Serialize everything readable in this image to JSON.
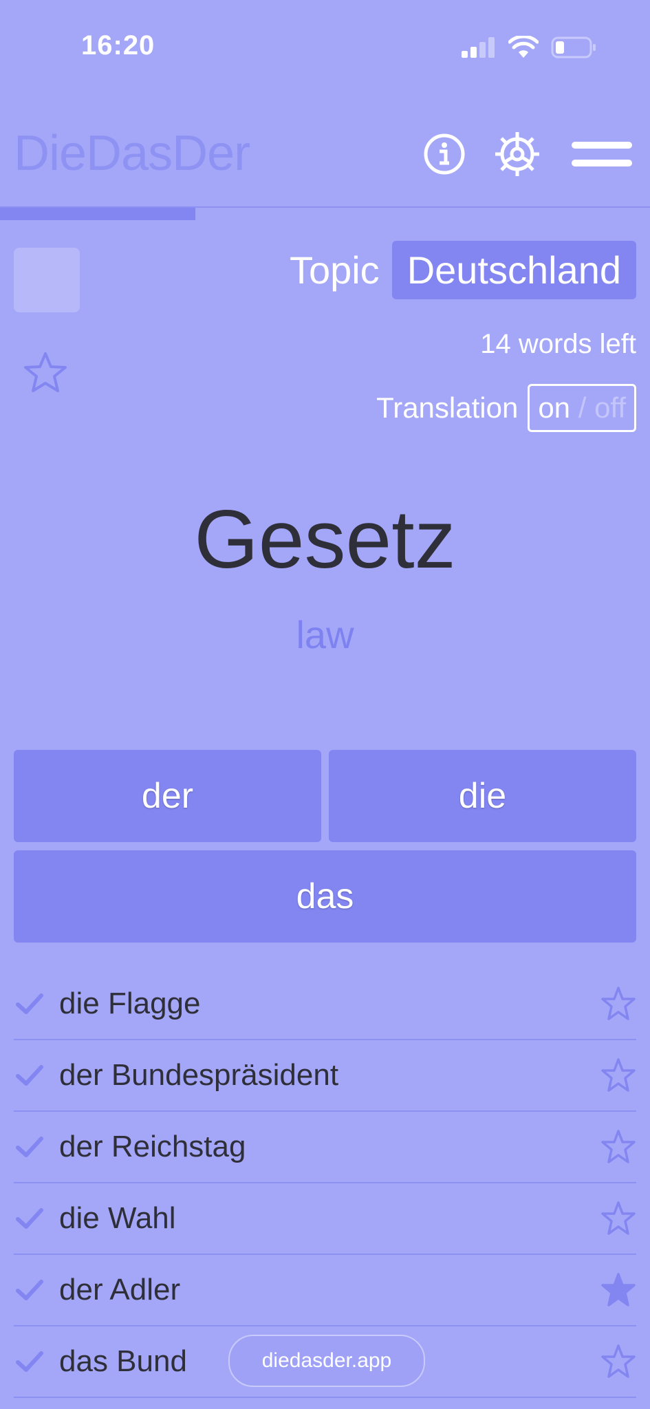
{
  "status_bar": {
    "time": "16:20",
    "icons": [
      "signal-icon",
      "wifi-icon",
      "battery-icon"
    ]
  },
  "header": {
    "title": "DieDasDer",
    "buttons": [
      "info-icon",
      "gear-icon",
      "menu-icon"
    ]
  },
  "progress": {
    "fraction": 0.3
  },
  "topic": {
    "label": "Topic",
    "value": "Deutschland"
  },
  "words_left": "14 words left",
  "translation": {
    "label": "Translation",
    "on": "on",
    "separator": " / ",
    "off": "off"
  },
  "card": {
    "word": "Gesetz",
    "translation": "law"
  },
  "articles": {
    "der": "der",
    "die": "die",
    "das": "das"
  },
  "history": [
    {
      "text": "die Flagge",
      "starred": false
    },
    {
      "text": "der Bundespräsident",
      "starred": false
    },
    {
      "text": "der Reichstag",
      "starred": false
    },
    {
      "text": "die Wahl",
      "starred": false
    },
    {
      "text": "der Adler",
      "starred": true
    },
    {
      "text": "das Bund",
      "starred": false
    }
  ],
  "url": "diedasder.app",
  "colors": {
    "background": "#a4a7f8",
    "accent": "#8386f1",
    "text_dark": "#2f2f3a",
    "title": "#8e92f2"
  }
}
